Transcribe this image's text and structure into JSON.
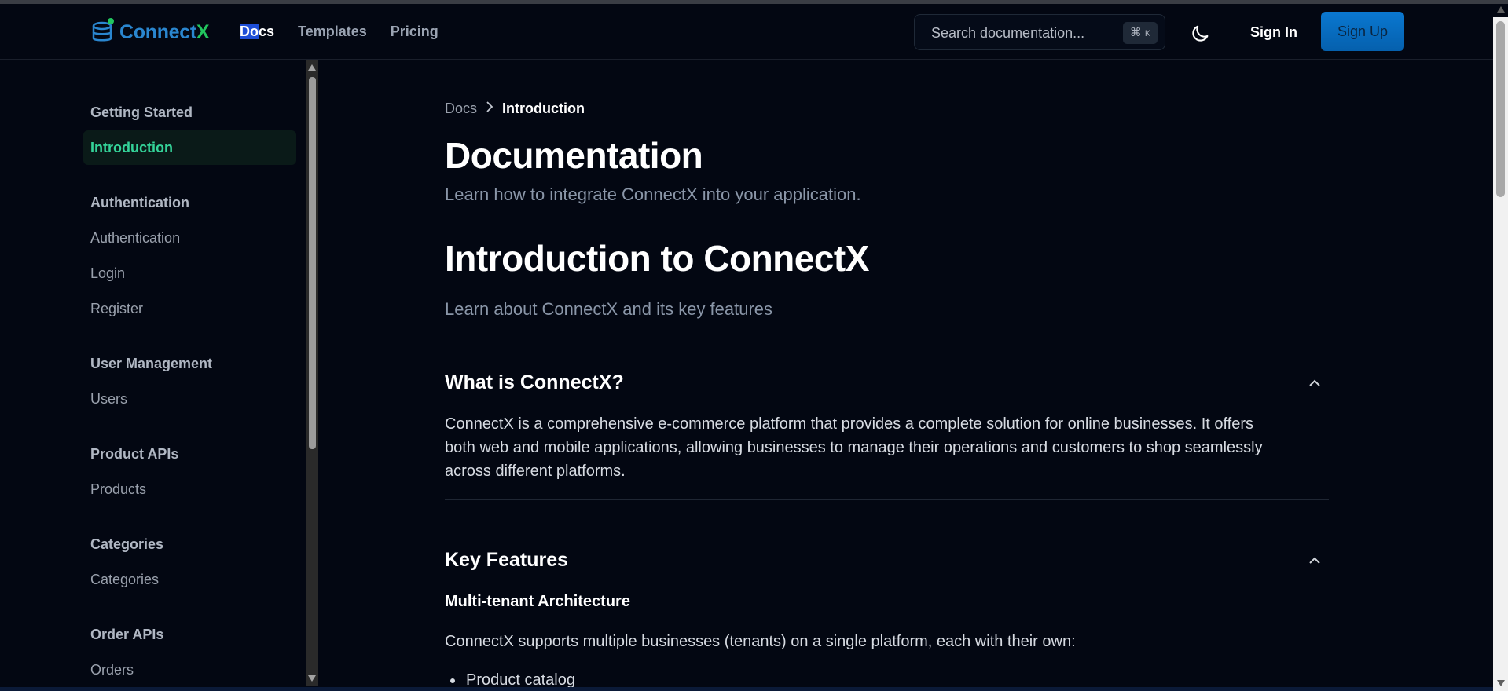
{
  "brand": {
    "name_part1": "Connect",
    "name_part2": "X"
  },
  "nav": {
    "links": [
      {
        "label_hl": "Do",
        "label_rest": "cs",
        "active": true
      },
      {
        "label": "Templates"
      },
      {
        "label": "Pricing"
      }
    ]
  },
  "search": {
    "placeholder": "Search documentation...",
    "shortcut_symbol": "⌘",
    "shortcut_key": "K"
  },
  "auth": {
    "sign_in": "Sign In",
    "sign_up": "Sign Up"
  },
  "sidebar": {
    "groups": [
      {
        "title": "Getting Started",
        "items": [
          "Introduction"
        ]
      },
      {
        "title": "Authentication",
        "items": [
          "Authentication",
          "Login",
          "Register"
        ]
      },
      {
        "title": "User Management",
        "items": [
          "Users"
        ]
      },
      {
        "title": "Product APIs",
        "items": [
          "Products"
        ]
      },
      {
        "title": "Categories",
        "items": [
          "Categories"
        ]
      },
      {
        "title": "Order APIs",
        "items": [
          "Orders"
        ]
      }
    ],
    "active_item": "Introduction"
  },
  "breadcrumb": {
    "root": "Docs",
    "current": "Introduction"
  },
  "page": {
    "title": "Documentation",
    "subtitle": "Learn how to integrate ConnectX into your application.",
    "heading": "Introduction to ConnectX",
    "heading_sub": "Learn about ConnectX and its key features"
  },
  "sections": {
    "what": {
      "title": "What is ConnectX?",
      "body_line1": "ConnectX is a comprehensive e-commerce platform that provides a complete solution for online businesses. It offers",
      "body_line2": "both web and mobile applications, allowing businesses to manage their operations and customers to shop seamlessly",
      "body_line3": "across different platforms."
    },
    "features": {
      "title": "Key Features",
      "subhead": "Multi-tenant Architecture",
      "body": "ConnectX supports multiple businesses (tenants) on a single platform, each with their own:",
      "bullets": [
        "Product catalog"
      ]
    }
  },
  "colors": {
    "accent_green": "#34d399",
    "brand_blue": "#2a86cf",
    "signup_bg": "#0a78d1"
  }
}
